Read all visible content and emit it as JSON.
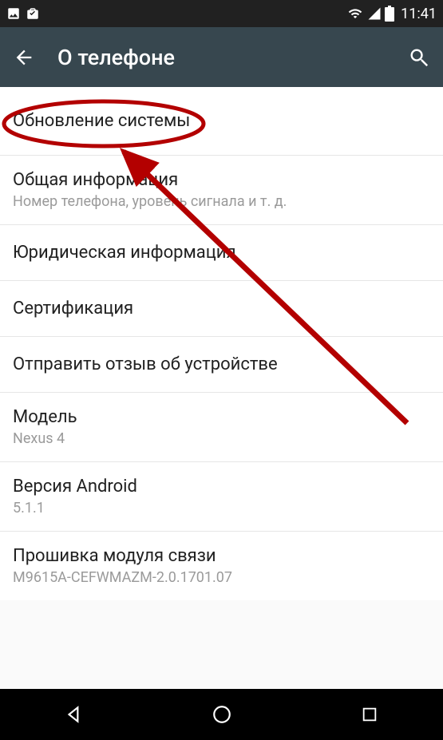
{
  "status": {
    "time": "11:41"
  },
  "appbar": {
    "title": "О телефоне"
  },
  "items": [
    {
      "title": "Обновление системы",
      "sub": null
    },
    {
      "title": "Общая информация",
      "sub": "Номер телефона, уровень сигнала и т. д."
    },
    {
      "title": "Юридическая информация",
      "sub": null
    },
    {
      "title": "Сертификация",
      "sub": null
    },
    {
      "title": "Отправить отзыв об устройстве",
      "sub": null
    },
    {
      "title": "Модель",
      "sub": "Nexus 4"
    },
    {
      "title": "Версия Android",
      "sub": "5.1.1"
    },
    {
      "title": "Прошивка модуля связи",
      "sub": "M9615A-CEFWMAZM-2.0.1701.07"
    }
  ]
}
